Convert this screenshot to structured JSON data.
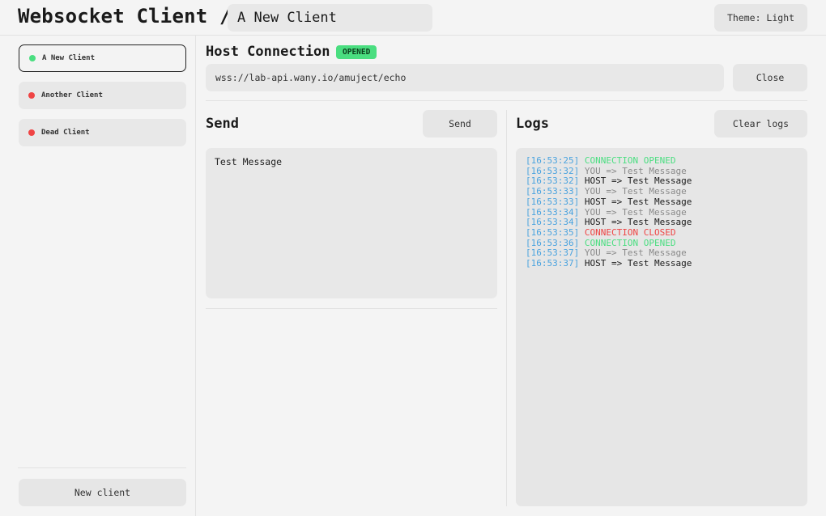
{
  "header": {
    "title": "Websocket Client /",
    "client_name": "A New Client",
    "theme_label": "Theme: Light"
  },
  "sidebar": {
    "clients": [
      {
        "label": "A New Client",
        "status": "connected"
      },
      {
        "label": "Another Client",
        "status": "disconnected"
      },
      {
        "label": "Dead Client",
        "status": "disconnected"
      }
    ],
    "new_client_label": "New client"
  },
  "host": {
    "title": "Host Connection",
    "status": "OPENED",
    "url": "wss://lab-api.wany.io/amuject/echo",
    "close_label": "Close"
  },
  "send": {
    "title": "Send",
    "button_label": "Send",
    "message": "Test Message"
  },
  "logs": {
    "title": "Logs",
    "clear_label": "Clear logs",
    "entries": [
      {
        "time": "[16:53:25]",
        "text": "CONNECTION OPENED",
        "kind": "opened"
      },
      {
        "time": "[16:53:32]",
        "text": "YOU => Test Message",
        "kind": "you"
      },
      {
        "time": "[16:53:32]",
        "text": "HOST => Test Message",
        "kind": "host"
      },
      {
        "time": "[16:53:33]",
        "text": "YOU => Test Message",
        "kind": "you"
      },
      {
        "time": "[16:53:33]",
        "text": "HOST => Test Message",
        "kind": "host"
      },
      {
        "time": "[16:53:34]",
        "text": "YOU => Test Message",
        "kind": "you"
      },
      {
        "time": "[16:53:34]",
        "text": "HOST => Test Message",
        "kind": "host"
      },
      {
        "time": "[16:53:35]",
        "text": "CONNECTION CLOSED",
        "kind": "closed"
      },
      {
        "time": "[16:53:36]",
        "text": "CONNECTION OPENED",
        "kind": "opened"
      },
      {
        "time": "[16:53:37]",
        "text": "YOU => Test Message",
        "kind": "you"
      },
      {
        "time": "[16:53:37]",
        "text": "HOST => Test Message",
        "kind": "host"
      }
    ]
  },
  "colors": {
    "background": "#f4f4f4",
    "panel": "#e8e8e8",
    "connected": "#4ade80",
    "disconnected": "#ef4444",
    "timestamp": "#4aa3df",
    "muted": "#8a8a8a"
  }
}
